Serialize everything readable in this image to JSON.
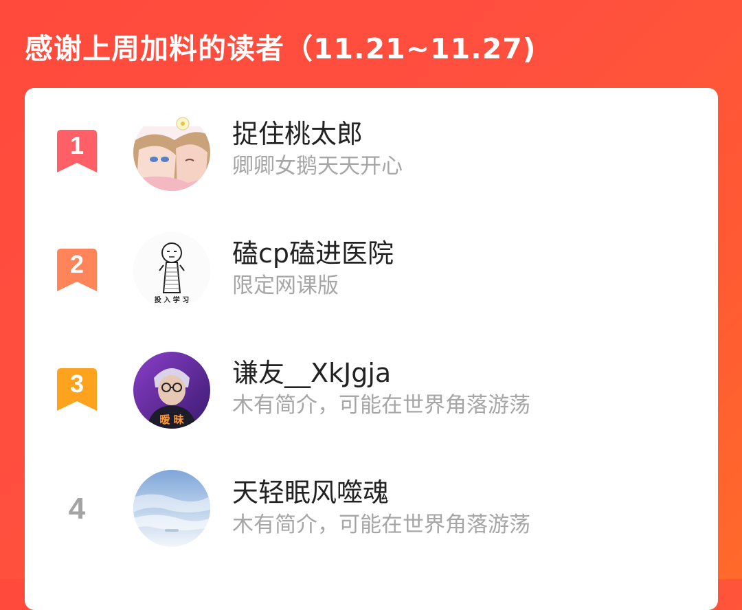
{
  "header": {
    "title": "感谢上周加料的读者（11.21~11.27)"
  },
  "colors": {
    "background": "#ff4f3f",
    "rank1": "#ff5f66",
    "rank2": "#ff845a",
    "rank3": "#ffa31e",
    "rank_plain": "#a3a3a3"
  },
  "readers": [
    {
      "rank": "1",
      "name": "捉住桃太郎",
      "bio": "卿卿女鹅天天开心",
      "avatar_icon": "anime-couple-avatar"
    },
    {
      "rank": "2",
      "name": "磕cp磕进医院",
      "bio": "限定网课版",
      "avatar_icon": "studying-stickman-avatar",
      "avatar_caption": "投 入 学 习"
    },
    {
      "rank": "3",
      "name": "谦友__XkJgja",
      "bio": "木有简介，可能在世界角落游荡",
      "avatar_icon": "purple-portrait-avatar",
      "avatar_caption": "暧 昧"
    },
    {
      "rank": "4",
      "name": "天轻眠风噬魂",
      "bio": "木有简介，可能在世界角落游荡",
      "avatar_icon": "sky-clouds-avatar"
    }
  ]
}
